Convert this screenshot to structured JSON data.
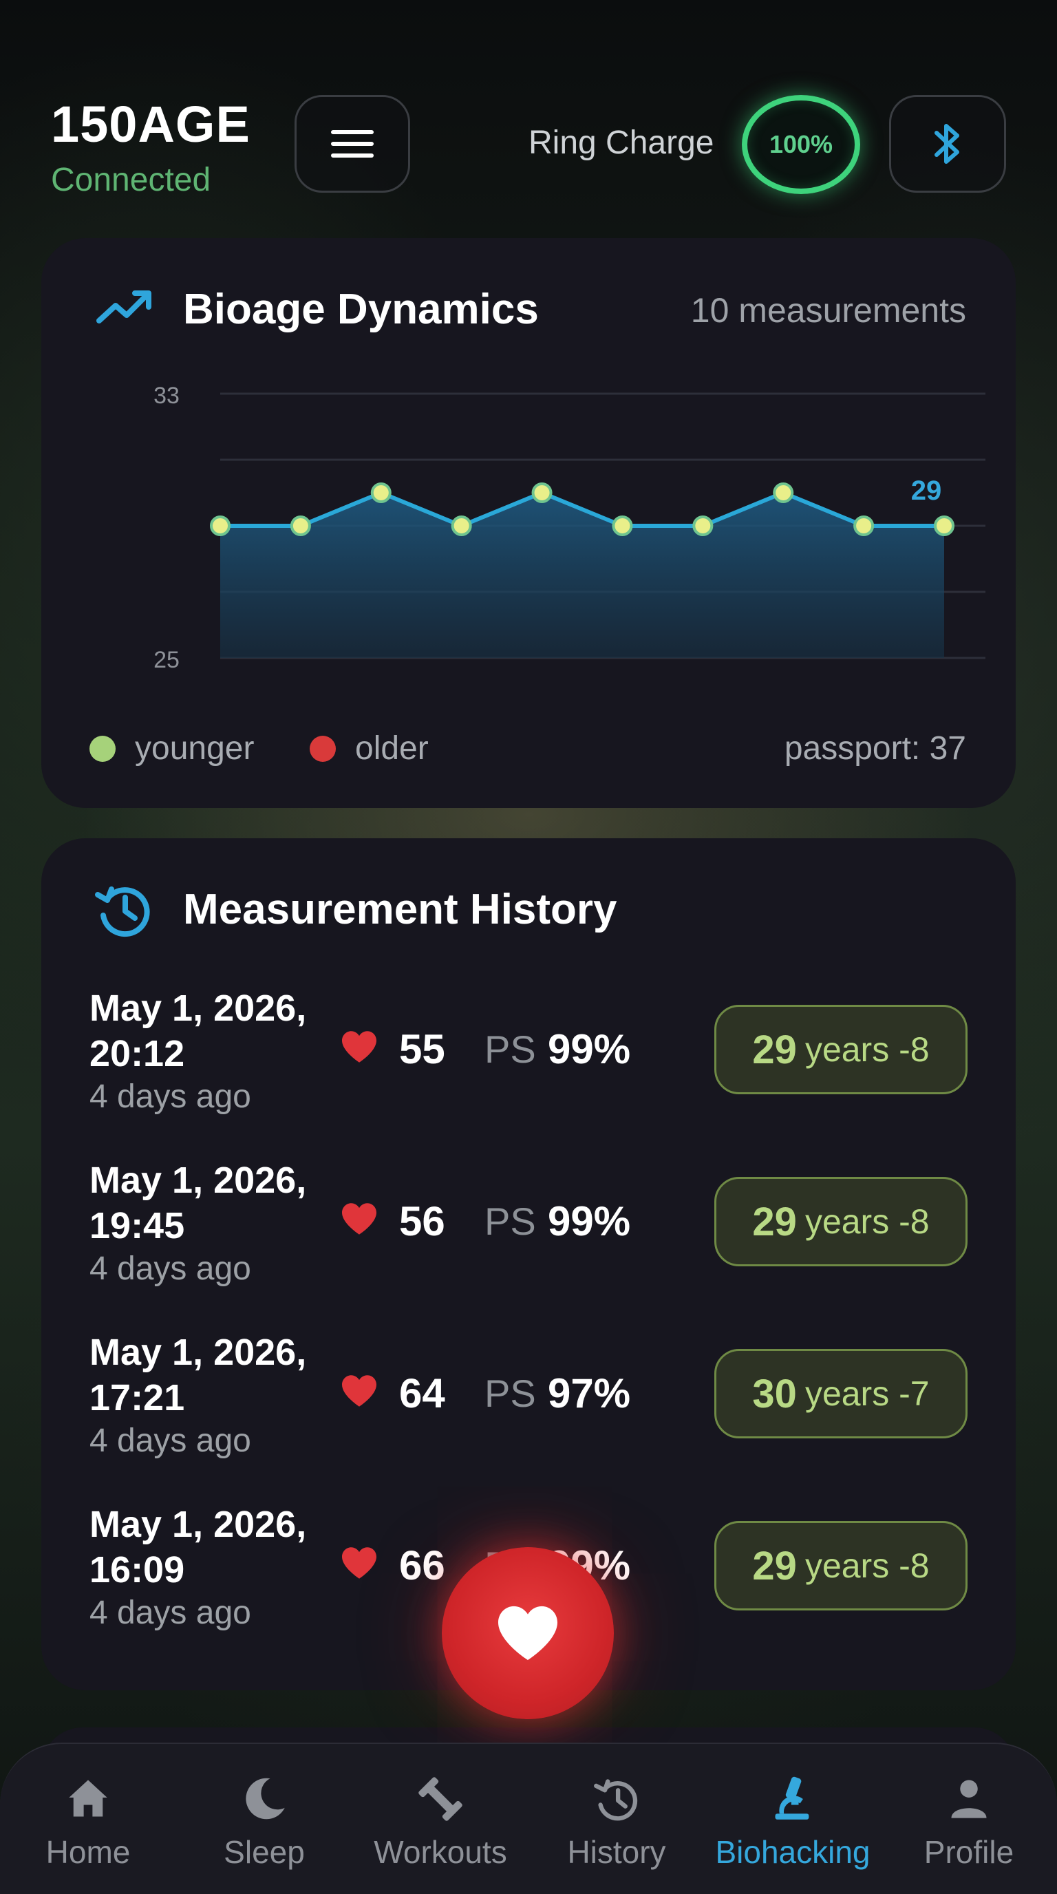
{
  "header": {
    "brand": "150AGE",
    "status": "Connected",
    "ring_label": "Ring Charge",
    "ring_charge": "100%",
    "icons": {
      "menu": "hamburger-menu-icon",
      "bluetooth": "bluetooth-icon"
    }
  },
  "dynamics": {
    "title": "Bioage Dynamics",
    "count": "10 measurements",
    "legend_younger": "younger",
    "legend_older": "older",
    "passport": "passport: 37",
    "colors": {
      "line": "#2aa8d8",
      "younger": "#a6d27a",
      "older": "#d93a3a"
    }
  },
  "chart_data": {
    "type": "area",
    "y_ticks": [
      "33",
      "25"
    ],
    "ylim": [
      25,
      33
    ],
    "x": [
      1,
      2,
      3,
      4,
      5,
      6,
      7,
      8,
      9,
      10
    ],
    "values": [
      29,
      29,
      30,
      29,
      30,
      29,
      29,
      30,
      29,
      29
    ],
    "last_label": "29",
    "grid": true
  },
  "history": {
    "title": "Measurement History",
    "rows": [
      {
        "date": "May 1, 2026,",
        "time": "20:12",
        "ago": "4 days ago",
        "hr": "55",
        "ps_label": "PS",
        "ps": "99%",
        "age": "29",
        "suffix": "years -8"
      },
      {
        "date": "May 1, 2026,",
        "time": "19:45",
        "ago": "4 days ago",
        "hr": "56",
        "ps_label": "PS",
        "ps": "99%",
        "age": "29",
        "suffix": "years -8"
      },
      {
        "date": "May 1, 2026,",
        "time": "17:21",
        "ago": "4 days ago",
        "hr": "64",
        "ps_label": "PS",
        "ps": "97%",
        "age": "30",
        "suffix": "years -7"
      },
      {
        "date": "May 1, 2026,",
        "time": "16:09",
        "ago": "4 days ago",
        "hr": "66",
        "ps_label": "PS",
        "ps": "99%",
        "age": "29",
        "suffix": "years -8"
      }
    ]
  },
  "nav": {
    "items": [
      {
        "label": "Home",
        "icon": "home-icon"
      },
      {
        "label": "Sleep",
        "icon": "moon-icon"
      },
      {
        "label": "Workouts",
        "icon": "dumbbell-icon"
      },
      {
        "label": "History",
        "icon": "history-icon"
      },
      {
        "label": "Biohacking",
        "icon": "microscope-icon"
      },
      {
        "label": "Profile",
        "icon": "person-icon"
      }
    ],
    "active": "Biohacking"
  }
}
